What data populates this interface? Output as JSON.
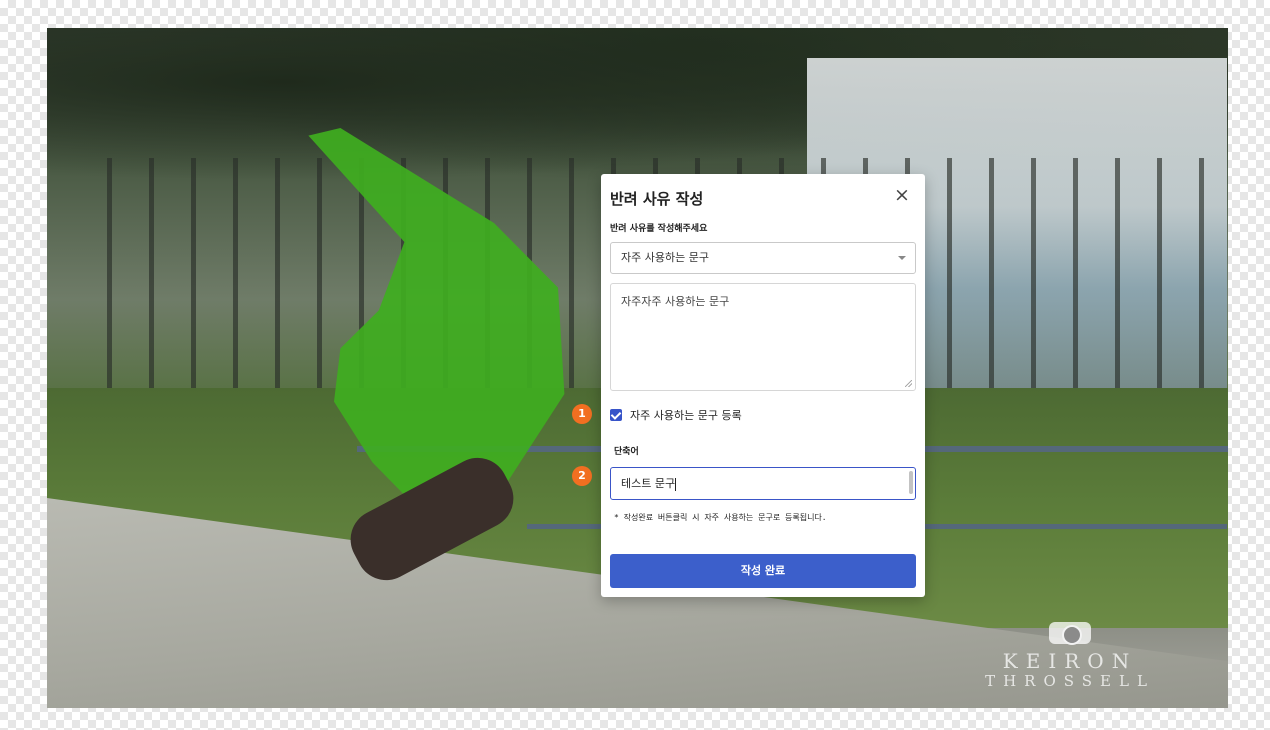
{
  "modal": {
    "title": "반려 사유 작성",
    "close_icon": "close-icon",
    "subtitle": "반려 사유를 작성해주세요",
    "select": {
      "selected": "자주 사용하는 문구"
    },
    "textarea": {
      "value": "자주자주 사용하는 문구"
    },
    "checkbox": {
      "label": "자주 사용하는 문구 등록",
      "checked": true
    },
    "abbr": {
      "label": "단축어",
      "value": "테스트 문구"
    },
    "note": "* 작성완료 버튼클릭 시 자주 사용하는 문구로 등록됩니다.",
    "submit_label": "작성 완료"
  },
  "steps": [
    "1",
    "2"
  ],
  "watermark": {
    "line1": "KEIRON",
    "line2": "THROSSELL"
  },
  "colors": {
    "accent": "#3c5fcb",
    "badge": "#f26f21",
    "mask": "#3fae1f"
  }
}
